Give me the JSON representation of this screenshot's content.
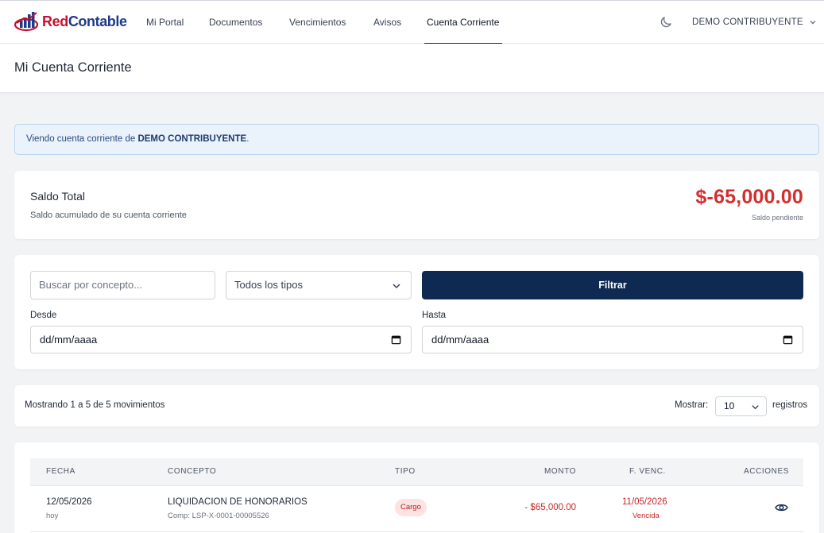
{
  "app": {
    "logo_red": "Red",
    "logo_blue": "Contable"
  },
  "nav": {
    "items": [
      {
        "label": "Mi Portal"
      },
      {
        "label": "Documentos"
      },
      {
        "label": "Vencimientos"
      },
      {
        "label": "Avisos"
      },
      {
        "label": "Cuenta Corriente",
        "active": true
      }
    ],
    "theme_icon": "moon-icon",
    "user_label": "DEMO CONTRIBUYENTE"
  },
  "page": {
    "title": "Mi Cuenta Corriente"
  },
  "alert": {
    "prefix": "Viendo cuenta corriente de",
    "name": "DEMO CONTRIBUYENTE",
    "suffix": "."
  },
  "saldo": {
    "title": "Saldo Total",
    "subtitle": "Saldo acumulado de su cuenta corriente",
    "amount": "$-65,000.00",
    "note": "Saldo pendiente"
  },
  "filters": {
    "search_placeholder": "Buscar por concepto...",
    "type_selected": "Todos los tipos",
    "filter_button": "Filtrar",
    "desde_label": "Desde",
    "hasta_label": "Hasta",
    "desde_value": "dd/mm/aaaa",
    "hasta_value": "dd/mm/aaaa"
  },
  "summary": {
    "count_text": "Mostrando 1 a 5 de 5 movimientos",
    "mostrar_label": "Mostrar:",
    "page_size": "10",
    "registros_label": "registros"
  },
  "table": {
    "headers": [
      "FECHA",
      "CONCEPTO",
      "TIPO",
      "MONTO",
      "F. VENC.",
      "ACCIONES"
    ],
    "rows": [
      {
        "fecha": "12/05/2026",
        "fecha_sub": "hoy",
        "concepto": "LIQUIDACION DE HONORARIOS",
        "concepto_sub": "Comp: LSP-X-0001-00005526",
        "tipo": "Cargo",
        "monto": "- $65,000.00",
        "venc": "11/05/2026",
        "venc_sub": "Vencida"
      }
    ]
  },
  "colors": {
    "brand_navy": "#0f2a52",
    "negative_red": "#d32f2f"
  }
}
